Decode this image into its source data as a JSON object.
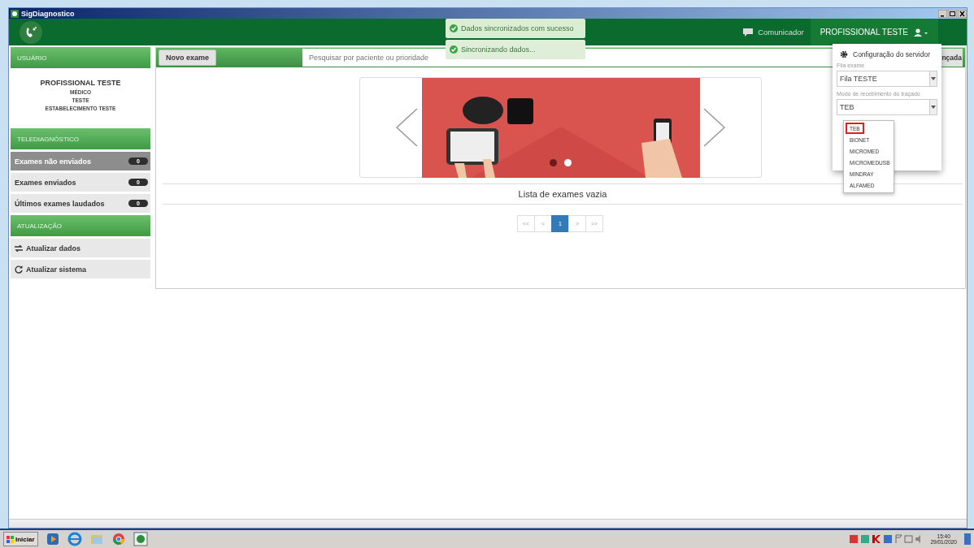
{
  "window": {
    "title": "SigDiagnostico"
  },
  "header": {
    "toasts": [
      {
        "text": "Dados sincronizados com sucesso"
      },
      {
        "text": "Sincronizando dados..."
      }
    ],
    "communicator": "Comunicador",
    "user": "PROFISSIONAL TESTE"
  },
  "sidebar": {
    "user_section": {
      "title": "USUÁRIO",
      "name": "PROFISSIONAL TESTE",
      "lines": [
        "MÉDICO",
        "TESTE",
        "ESTABELECIMENTO TESTE"
      ]
    },
    "tele_section": {
      "title": "TELEDIAGNÓSTICO",
      "items": [
        {
          "label": "Exames não enviados",
          "count": "0",
          "selected": true
        },
        {
          "label": "Exames enviados",
          "count": "0",
          "selected": false
        },
        {
          "label": "Últimos exames laudados",
          "count": "0",
          "selected": false
        }
      ]
    },
    "update_section": {
      "title": "ATUALIZAÇÃO",
      "items": [
        {
          "label": "Atualizar dados",
          "kind": "sync"
        },
        {
          "label": "Atualizar sistema",
          "kind": "refresh"
        }
      ]
    }
  },
  "main": {
    "new_button": "Novo exame",
    "search": {
      "placeholder": "Pesquisar por paciente ou prioridade"
    },
    "advanced_button": "nçada",
    "carousel": {
      "indicators": [
        {
          "selected": true
        },
        {
          "selected": false
        }
      ]
    },
    "empty_message": "Lista de exames vazia",
    "pagination": [
      {
        "label": "<<",
        "selected": false
      },
      {
        "label": "<",
        "selected": false
      },
      {
        "label": "1",
        "selected": true
      },
      {
        "label": ">",
        "selected": false
      },
      {
        "label": ">>",
        "selected": false
      }
    ]
  },
  "server_menu": {
    "title": "Configuração do servidor",
    "queue": {
      "label": "Fila exame",
      "value": "Fila TESTE"
    },
    "mode": {
      "label": "Modo de recebimento do traçado",
      "value": "TEB",
      "options": [
        {
          "label": "TEB",
          "selected": true
        },
        {
          "label": "BIONET",
          "selected": false
        },
        {
          "label": "MICROMED",
          "selected": false
        },
        {
          "label": "MICROMEDUSB",
          "selected": false
        },
        {
          "label": "MINDRAY",
          "selected": false
        },
        {
          "label": "ALFAMED",
          "selected": false
        }
      ]
    }
  },
  "taskbar": {
    "start": "Iniciar",
    "time": "15:40",
    "date": "29/01/2020"
  }
}
